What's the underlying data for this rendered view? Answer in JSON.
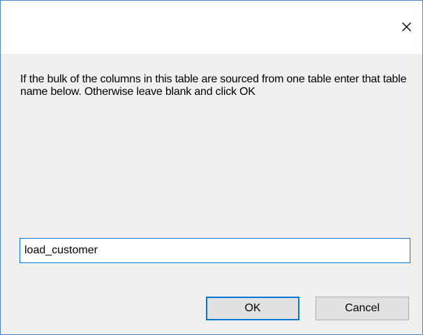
{
  "dialog": {
    "close_icon": "close-icon",
    "message": "If the bulk of the columns in this table are sourced from one table enter that table name below. Otherwise leave blank and click OK",
    "input_value": "load_customer",
    "ok_label": "OK",
    "cancel_label": "Cancel",
    "colors": {
      "border": "#4a83c9",
      "body_bg": "#f0f0f0",
      "focus": "#0078d7",
      "button_bg": "#e1e1e1"
    }
  }
}
